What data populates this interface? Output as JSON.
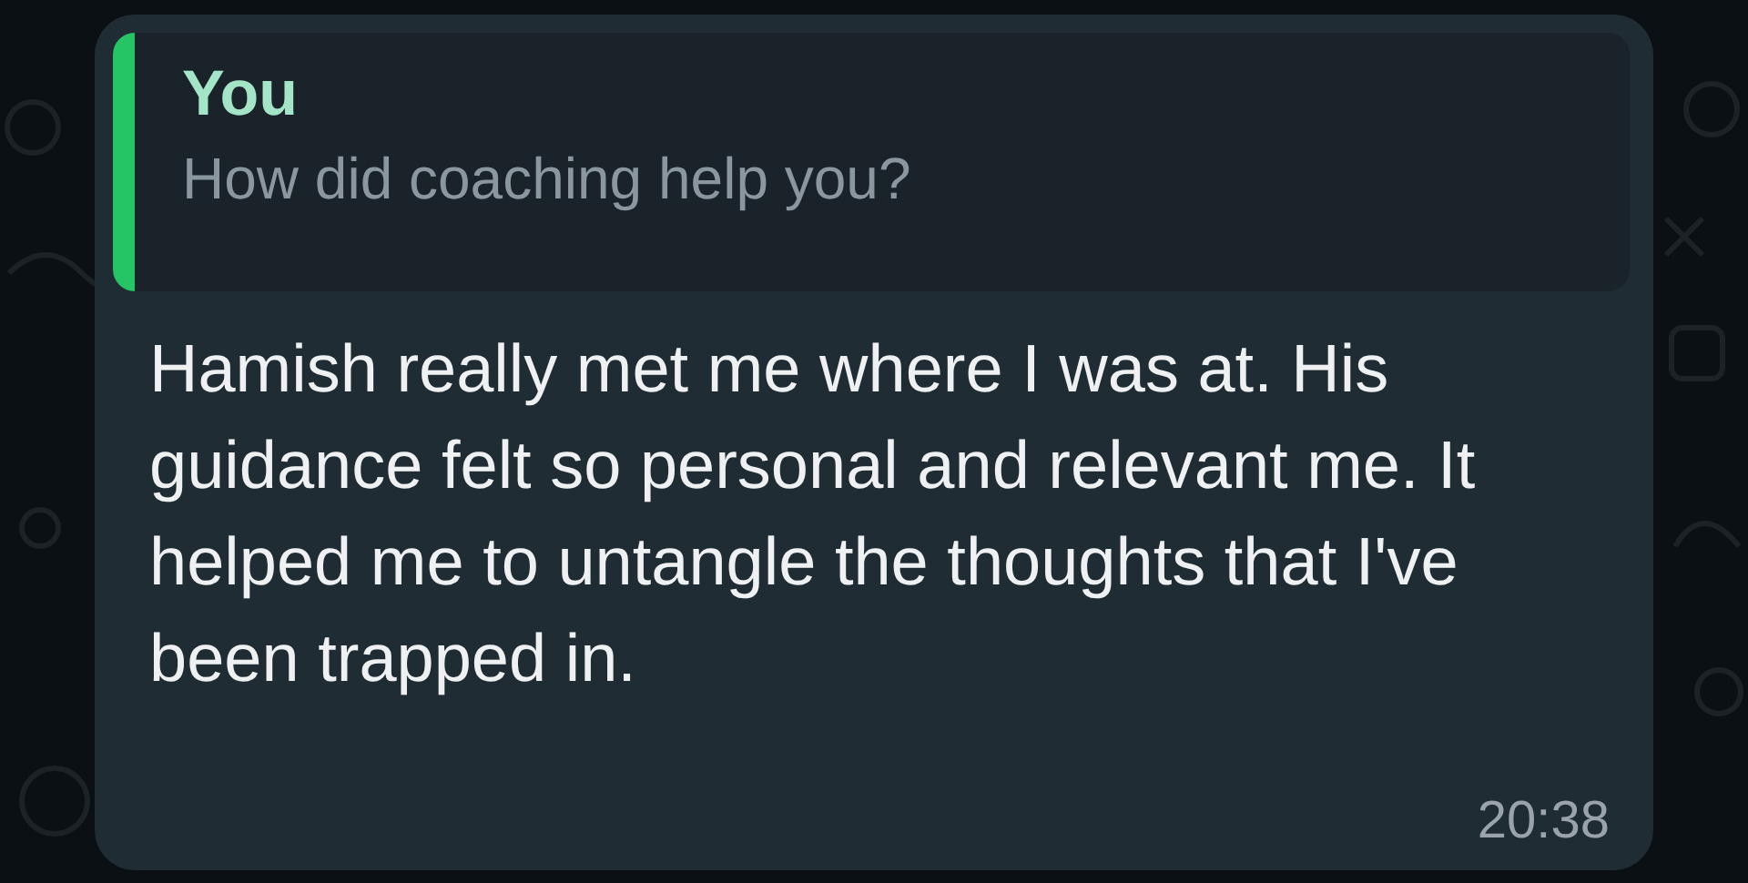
{
  "message": {
    "quote": {
      "author": "You",
      "text": "How did coaching help you?"
    },
    "text": "Hamish really met me where I was at. His guidance felt so personal and relevant me. It helped me to untangle the thoughts that I've been trapped in.",
    "time": "20:38"
  }
}
